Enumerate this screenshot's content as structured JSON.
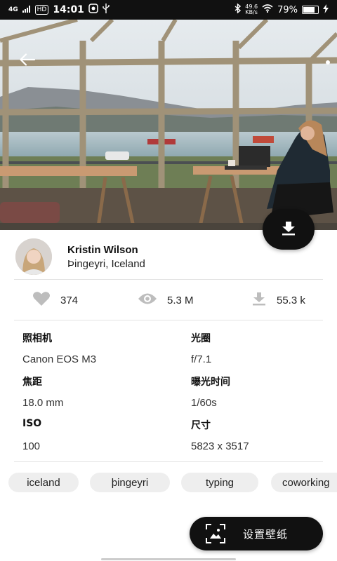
{
  "status_bar": {
    "network": "4G",
    "hd": "HD",
    "time": "14:01",
    "speed_value": "49.6",
    "speed_unit": "KB/s",
    "battery": "79%",
    "battery_level": 0.79
  },
  "photo": {
    "author_name": "Kristin Wilson",
    "author_location": "Þingeyri, Iceland"
  },
  "stats": {
    "likes": "374",
    "views": "5.3 M",
    "downloads": "55.3 k"
  },
  "specs": [
    {
      "label": "照相机",
      "value": "Canon EOS M3"
    },
    {
      "label": "光圈",
      "value": "f/7.1"
    },
    {
      "label": "焦距",
      "value": "18.0 mm"
    },
    {
      "label": "曝光时间",
      "value": "1/60s"
    },
    {
      "label": "ISO",
      "value": "100"
    },
    {
      "label": "尺寸",
      "value": "5823 x 3517"
    }
  ],
  "tags": [
    "iceland",
    "þingeyri",
    "typing",
    "coworking"
  ],
  "actions": {
    "set_wallpaper": "设置壁纸"
  },
  "icons": {
    "back": "back-arrow-icon",
    "download": "download-icon",
    "like": "heart-icon",
    "views": "eye-icon",
    "downloads": "download-count-icon",
    "wallpaper": "wallpaper-icon"
  }
}
